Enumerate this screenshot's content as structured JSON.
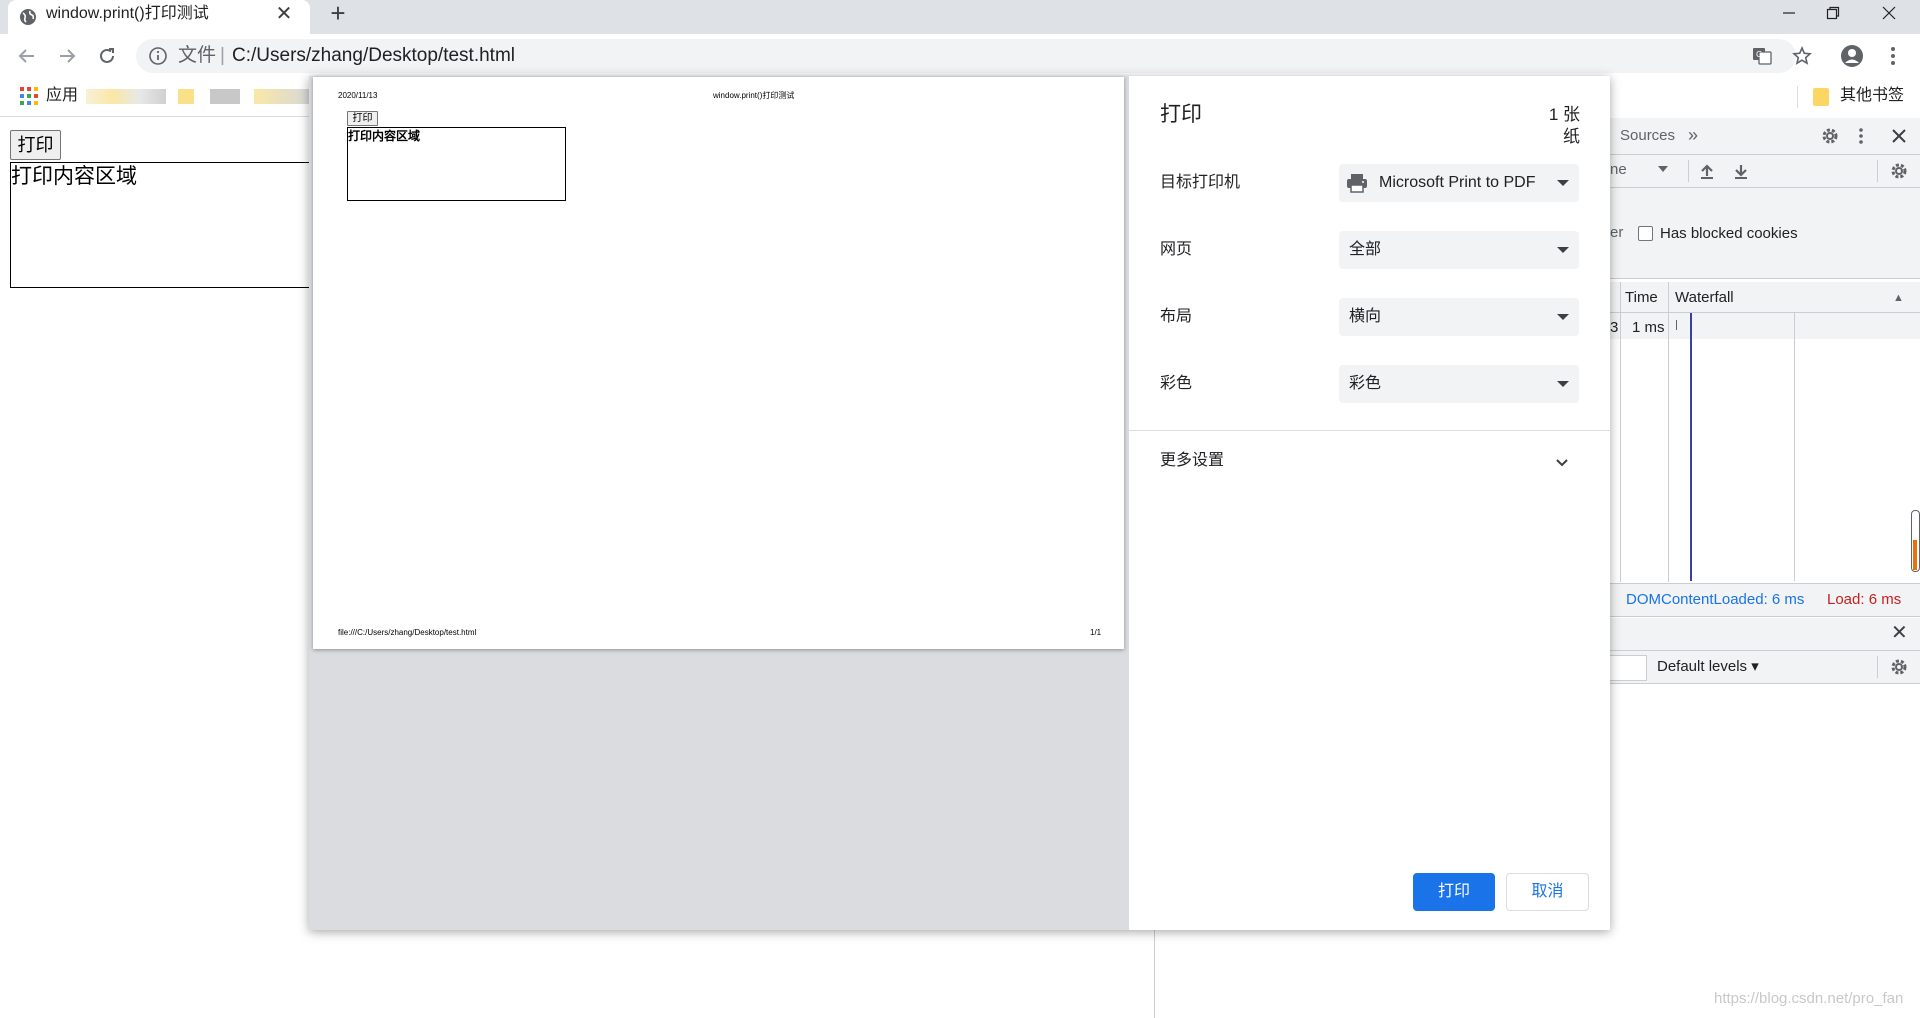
{
  "browser": {
    "tab_title": "window.print()打印测试",
    "tab_close": "✕",
    "new_tab": "+",
    "omnibox": {
      "scheme": "文件",
      "separator": "|",
      "url": "C:/Users/zhang/Desktop/test.html"
    },
    "bookmarks": {
      "apps_label": "应用",
      "other_label": "其他书签"
    },
    "icons": [
      "globe-icon",
      "back-icon",
      "forward-icon",
      "reload-icon",
      "info-icon",
      "translate-icon",
      "star-icon",
      "account-icon",
      "menu-icon",
      "minimize-icon",
      "restore-icon",
      "close-window-icon",
      "apps-grid-icon",
      "folder-icon"
    ]
  },
  "page": {
    "print_button": "打印",
    "box_text": "打印内容区域"
  },
  "devtools": {
    "tab_sources": "Sources",
    "more_tabs": "»",
    "partial_filter_text": "er",
    "has_blocked_cookies": "Has blocked cookies",
    "partial_throttle_text": "ne",
    "col_time": "Time",
    "col_waterfall": "Waterfall",
    "row_partial": "3",
    "row_time": "1 ms",
    "dom_content_loaded": "DOMContentLoaded: 6 ms",
    "load": "Load: 6 ms",
    "drawer_close": "✕",
    "default_levels": "Default levels ▾",
    "colors": {
      "dcl": "#1a73e8",
      "load": "#c5221f",
      "waterfall_line": "#3c3ea8"
    }
  },
  "print_dialog": {
    "title": "打印",
    "sheets": "1 张纸",
    "preview": {
      "date": "2020/11/13",
      "title": "window.print()打印测试",
      "button": "打印",
      "box_text": "打印内容区域",
      "footer_url": "file:///C:/Users/zhang/Desktop/test.html",
      "page_number": "1/1"
    },
    "settings": {
      "destination": {
        "label": "目标打印机",
        "value": "Microsoft Print to PDF"
      },
      "pages": {
        "label": "网页",
        "value": "全部"
      },
      "layout": {
        "label": "布局",
        "value": "横向"
      },
      "color": {
        "label": "彩色",
        "value": "彩色"
      },
      "more_settings": "更多设置"
    },
    "buttons": {
      "print": "打印",
      "cancel": "取消"
    },
    "colors": {
      "primary": "#1a73e8"
    }
  },
  "watermark": "https://blog.csdn.net/pro_fan"
}
